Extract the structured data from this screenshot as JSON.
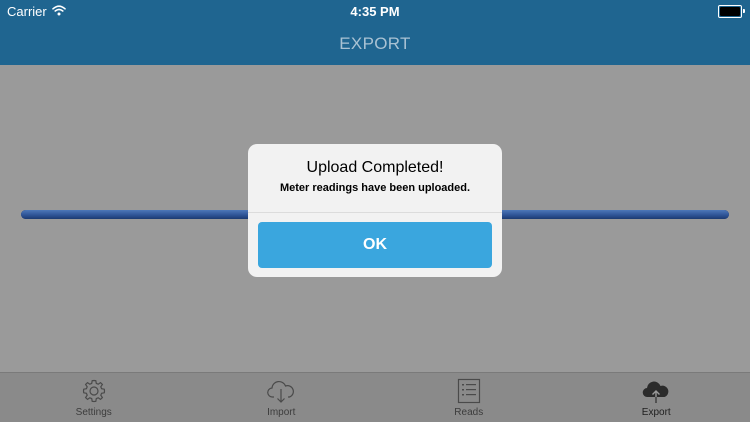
{
  "status_bar": {
    "carrier": "Carrier",
    "time": "4:35 PM",
    "battery_level": 1.0
  },
  "nav": {
    "title": "EXPORT"
  },
  "progress": {
    "value": 1.0
  },
  "alert": {
    "title": "Upload Completed!",
    "message": "Meter readings have been uploaded.",
    "button_label": "OK"
  },
  "tabs": [
    {
      "label": "Settings",
      "icon": "gear-icon"
    },
    {
      "label": "Import",
      "icon": "cloud-download-icon"
    },
    {
      "label": "Reads",
      "icon": "list-icon"
    },
    {
      "label": "Export",
      "icon": "cloud-upload-icon",
      "active": true
    }
  ],
  "colors": {
    "nav_background": "#1f6590",
    "alert_button": "#3aa6de",
    "progress_bar": "#2f5597"
  }
}
